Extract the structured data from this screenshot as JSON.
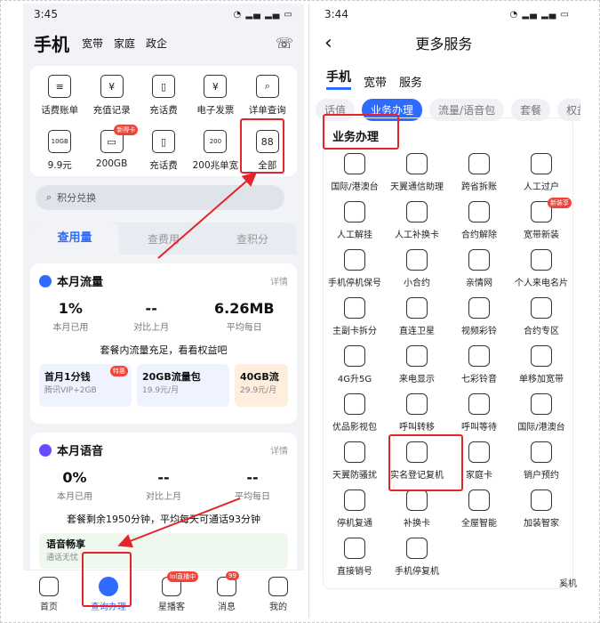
{
  "left": {
    "time": "3:45",
    "title": "手机",
    "top_tabs": [
      "宽带",
      "家庭",
      "政企"
    ],
    "shortcuts": [
      {
        "label": "话费账单",
        "icon": "bill-icon",
        "glyph": "≡"
      },
      {
        "label": "充值记录",
        "icon": "yuan-receipt-icon",
        "glyph": "¥"
      },
      {
        "label": "充话费",
        "icon": "phone-icon",
        "glyph": "▯"
      },
      {
        "label": "电子发票",
        "icon": "invoice-icon",
        "glyph": "¥"
      },
      {
        "label": "详单查询",
        "icon": "detail-search-icon",
        "glyph": "⌕"
      },
      {
        "label": "9.9元",
        "icon": "10gb-icon",
        "glyph": "10GB"
      },
      {
        "label": "200GB",
        "icon": "gift-icon",
        "glyph": "▭",
        "badge": "新得卡"
      },
      {
        "label": "充话费",
        "icon": "phone-icon",
        "glyph": "▯"
      },
      {
        "label": "200兆单宽",
        "icon": "200m-icon",
        "glyph": "200"
      },
      {
        "label": "全部",
        "icon": "all-grid-icon",
        "glyph": "88"
      }
    ],
    "search_placeholder": "积分兑换",
    "query_tabs": [
      "查用量",
      "查费用",
      "查积分"
    ],
    "data_card": {
      "title": "本月流量",
      "detail": "详情",
      "stats": [
        {
          "value": "1%",
          "label": "本月已用"
        },
        {
          "value": "--",
          "label": "对比上月"
        },
        {
          "value": "6.26MB",
          "label": "平均每日"
        }
      ],
      "hint": "套餐内流量充足，看看权益吧",
      "promos": [
        {
          "title": "首月1分钱",
          "sub": "腾讯VIP+2GB",
          "tag": "特惠"
        },
        {
          "title": "20GB流量包",
          "sub": "19.9元/月"
        },
        {
          "title": "40GB流",
          "sub": "29.9元/月"
        }
      ]
    },
    "voice_card": {
      "title": "本月语音",
      "detail": "详情",
      "stats": [
        {
          "value": "0%",
          "label": "本月已用"
        },
        {
          "value": "--",
          "label": "对比上月"
        },
        {
          "value": "--",
          "label": "平均每日"
        }
      ],
      "hint": "套餐剩余1950分钟，平均每天可通话93分钟",
      "promo_title": "语音畅享",
      "promo_sub": "通话无忧"
    },
    "nav": [
      {
        "label": "首页",
        "icon": "home-icon"
      },
      {
        "label": "查询办理",
        "icon": "query-icon"
      },
      {
        "label": "星播客",
        "icon": "play-icon",
        "badge": "lol直播中"
      },
      {
        "label": "消息",
        "icon": "bell-icon",
        "badge": "99"
      },
      {
        "label": "我的",
        "icon": "user-icon"
      }
    ]
  },
  "right": {
    "time": "3:44",
    "back": "‹",
    "title": "更多服务",
    "type_tabs": [
      "手机",
      "宽带",
      "服务"
    ],
    "chips": [
      "话值",
      "业务办理",
      "流量/语音包",
      "套餐",
      "权益"
    ],
    "section_title": "业务办理",
    "items": [
      {
        "label": "国际/港澳台",
        "icon": "globe-icon"
      },
      {
        "label": "天翼通信助理",
        "icon": "call-assistant-icon"
      },
      {
        "label": "跨省拆账",
        "icon": "map-icon"
      },
      {
        "label": "人工过户",
        "icon": "transfer-user-icon"
      },
      {
        "label": "人工解挂",
        "icon": "unlock-doc-icon"
      },
      {
        "label": "人工补换卡",
        "icon": "card-swap-icon"
      },
      {
        "label": "合约解除",
        "icon": "contract-cancel-icon"
      },
      {
        "label": "宽带新装",
        "icon": "broadband-icon",
        "badge": "新装享"
      },
      {
        "label": "手机停机保号",
        "icon": "phone-pause-icon"
      },
      {
        "label": "小合约",
        "icon": "small-contract-icon"
      },
      {
        "label": "亲情网",
        "icon": "family-icon"
      },
      {
        "label": "个人来电名片",
        "icon": "caller-card-icon"
      },
      {
        "label": "主副卡拆分",
        "icon": "card-split-icon"
      },
      {
        "label": "直连卫星",
        "icon": "satellite-icon"
      },
      {
        "label": "视频彩铃",
        "icon": "video-ring-icon"
      },
      {
        "label": "合约专区",
        "icon": "contract-zone-icon"
      },
      {
        "label": "4G升5G",
        "icon": "5g-icon"
      },
      {
        "label": "来电显示",
        "icon": "caller-id-icon"
      },
      {
        "label": "七彩铃音",
        "icon": "ringtone-icon"
      },
      {
        "label": "单移加宽带",
        "icon": "mobile-broadband-icon"
      },
      {
        "label": "优品影视包",
        "icon": "video-pack-icon"
      },
      {
        "label": "呼叫转移",
        "icon": "call-forward-icon"
      },
      {
        "label": "呼叫等待",
        "icon": "call-wait-icon"
      },
      {
        "label": "国际/港澳台",
        "icon": "globe-icon"
      },
      {
        "label": "天翼防骚扰",
        "icon": "alarm-icon"
      },
      {
        "label": "实名登记复机",
        "icon": "id-register-icon"
      },
      {
        "label": "家庭卡",
        "icon": "family-card-icon"
      },
      {
        "label": "销户预约",
        "icon": "cancel-account-icon"
      },
      {
        "label": "停机复通",
        "icon": "resume-icon"
      },
      {
        "label": "补换卡",
        "icon": "card-replace-icon"
      },
      {
        "label": "全屋智能",
        "icon": "smart-home-icon"
      },
      {
        "label": "加装智家",
        "icon": "add-home-icon"
      },
      {
        "label": "直接销号",
        "icon": "close-number-icon"
      },
      {
        "label": "手机停复机",
        "icon": "phone-stop-icon"
      }
    ],
    "watermark": "奚机"
  },
  "colors": {
    "accent": "#2f6bff",
    "annotation": "#e5232a"
  }
}
